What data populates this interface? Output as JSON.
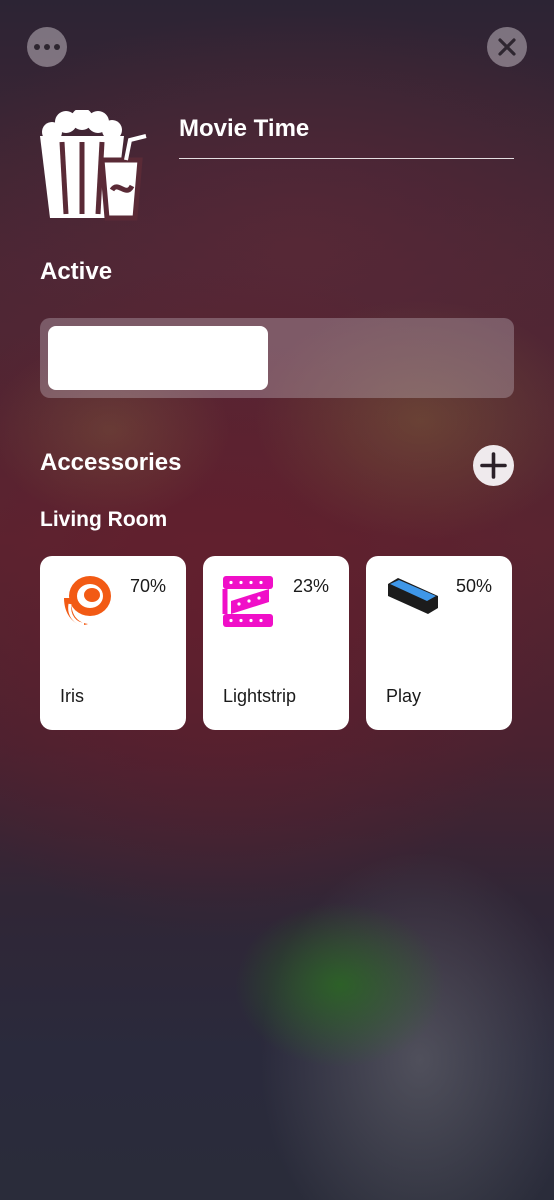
{
  "header": {
    "more_icon": "ellipsis-icon",
    "close_icon": "close-icon"
  },
  "scene": {
    "icon": "popcorn-and-drink-icon",
    "name": "Movie Time"
  },
  "active": {
    "heading": "Active",
    "level": 0.48
  },
  "accessories": {
    "heading": "Accessories",
    "add_icon": "plus-icon",
    "room": "Living Room",
    "items": [
      {
        "name": "Iris",
        "percent": "70%",
        "icon": "iris-lamp-icon",
        "color": "#f25a14"
      },
      {
        "name": "Lightstrip",
        "percent": "23%",
        "icon": "lightstrip-icon",
        "color": "#f00fc8"
      },
      {
        "name": "Play",
        "percent": "50%",
        "icon": "play-bar-icon",
        "color": "#3f97e8"
      }
    ]
  }
}
